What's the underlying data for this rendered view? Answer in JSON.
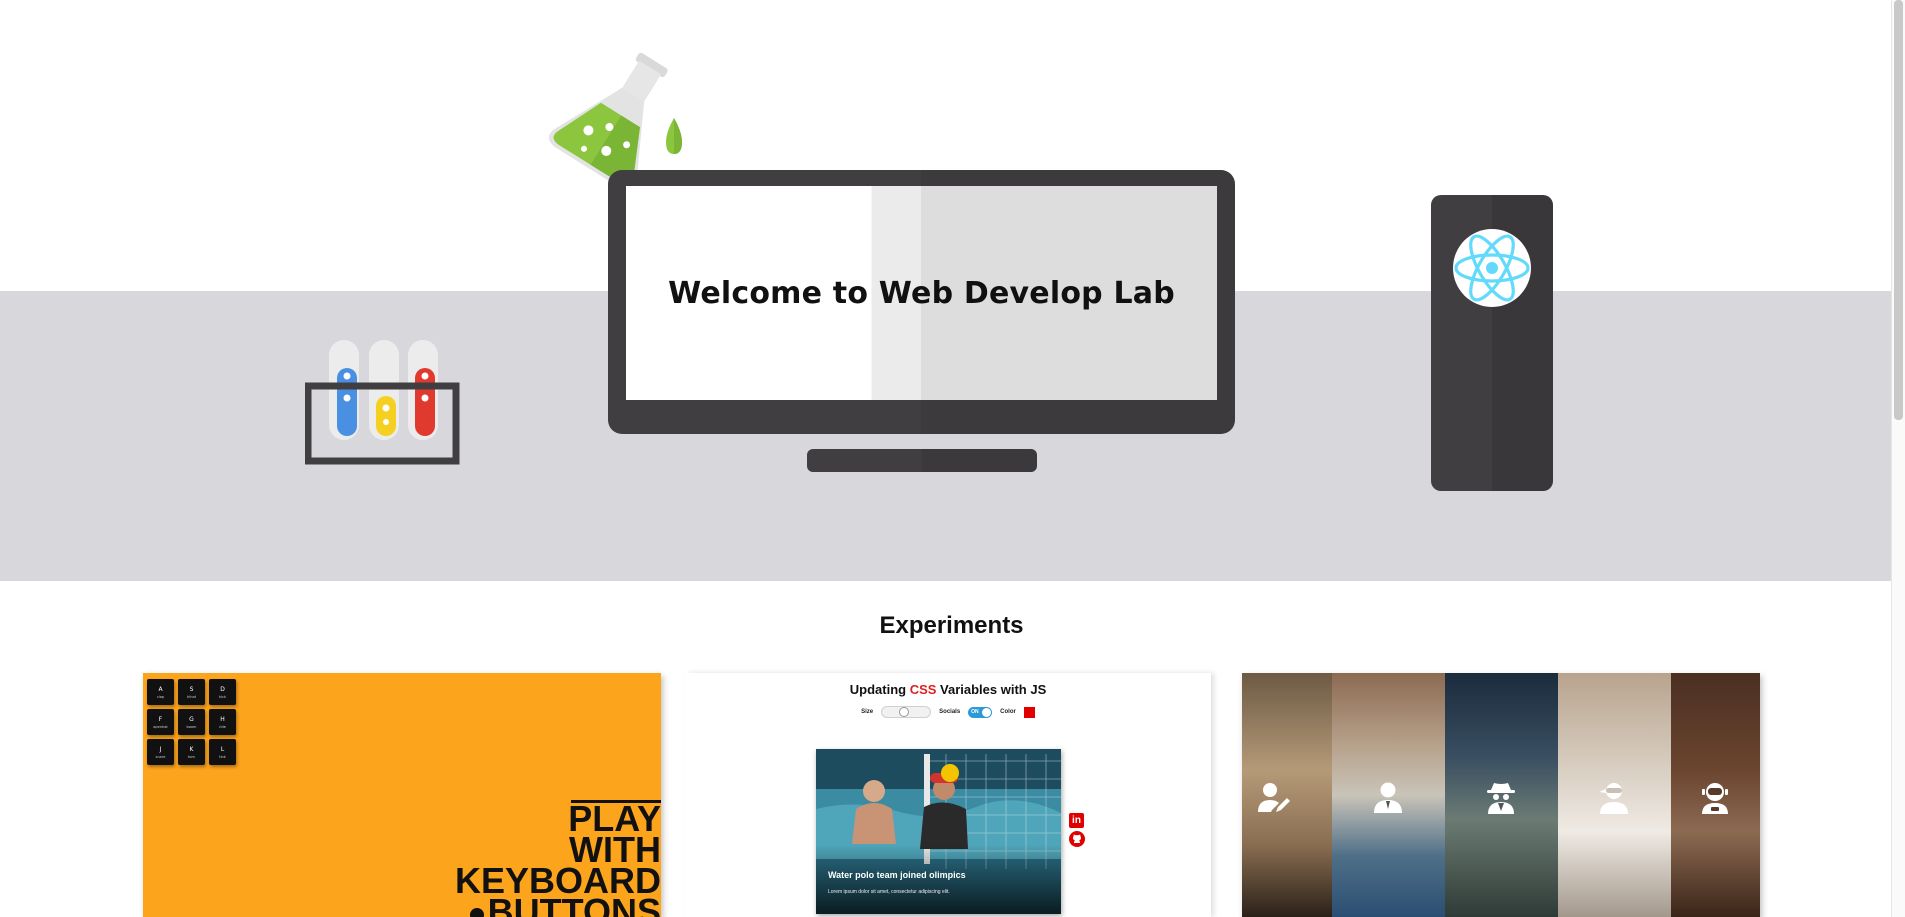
{
  "hero": {
    "welcome_text": "Welcome to Web Develop Lab",
    "monitor_icon": "monitor",
    "tower_icon": "react-logo-icon",
    "flask_icon": "flask-icon",
    "tubes_icon": "test-tubes-icon",
    "colors": {
      "desk": "#d8d8dc",
      "device": "#403e40",
      "flask_liquid": "#8cc63f",
      "react": "#61dafb",
      "tube_blue": "#4a90e2",
      "tube_yellow": "#f5d020",
      "tube_red": "#e03a2f"
    }
  },
  "experiments": {
    "title": "Experiments",
    "keyboard_card": {
      "keys": [
        {
          "key": "A",
          "sound": "clap"
        },
        {
          "key": "S",
          "sound": "hihat"
        },
        {
          "key": "D",
          "sound": "kick"
        },
        {
          "key": "F",
          "sound": "openhat"
        },
        {
          "key": "G",
          "sound": "boom"
        },
        {
          "key": "H",
          "sound": "ride"
        },
        {
          "key": "J",
          "sound": "snare"
        },
        {
          "key": "K",
          "sound": "tom"
        },
        {
          "key": "L",
          "sound": "tink"
        }
      ],
      "headline": [
        "PLAY",
        "WITH",
        "KEYBOARD",
        "BUTTONS"
      ],
      "background": "#fda41d"
    },
    "css_card": {
      "title_before": "Updating ",
      "title_accent": "CSS",
      "title_after": " Variables with JS",
      "size_label": "Size",
      "socials_label": "Socials",
      "socials_state": "ON",
      "color_label": "Color",
      "color_value": "#e00000",
      "photo_title": "Water polo team joined olimpics",
      "photo_text": "Lorem ipsum dolor sit amet, consectetur adipiscing elit.",
      "social_icons": [
        "linkedin-icon",
        "github-icon"
      ]
    },
    "avatar_card": {
      "icons": [
        "designer-icon",
        "user-icon",
        "spy-icon",
        "user-ninja-icon",
        "astronaut-icon"
      ]
    }
  }
}
